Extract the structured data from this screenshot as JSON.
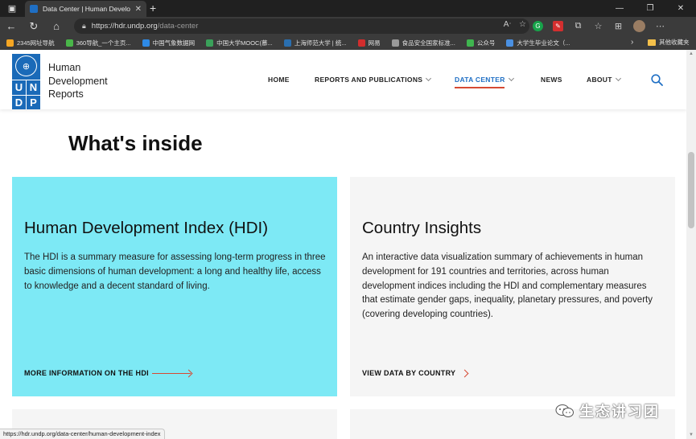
{
  "browser": {
    "tab_title": "Data Center | Human Development Reports",
    "new_tab": "+",
    "url_host": "https://hdr.undp.org",
    "url_path": "/data-center",
    "bookmarks": [
      {
        "label": "2345网址导航",
        "color": "#f5a623"
      },
      {
        "label": "360导航_一个主页...",
        "color": "#49b649"
      },
      {
        "label": "中国气象数据网",
        "color": "#2e8ae6"
      },
      {
        "label": "中国大学MOOC(慕...",
        "color": "#3aa15a"
      },
      {
        "label": "上海师范大学 | 统...",
        "color": "#2a6fb0"
      },
      {
        "label": "网易",
        "color": "#d22d2d"
      },
      {
        "label": "食品安全国家标准...",
        "color": "#9a9a9a"
      },
      {
        "label": "公众号",
        "color": "#3fb54f"
      },
      {
        "label": "大学生毕业论文（...",
        "color": "#4a90e2"
      }
    ],
    "bookmarks_more": "›",
    "other_bookmarks": "其他收藏夹",
    "status_url": "https://hdr.undp.org/data-center/human-development-index"
  },
  "site": {
    "logo_letters": [
      "U",
      "N",
      "D",
      "P"
    ],
    "brand_lines": [
      "Human",
      "Development",
      "Reports"
    ],
    "nav": [
      {
        "label": "HOME",
        "has_dropdown": false,
        "active": false
      },
      {
        "label": "REPORTS AND PUBLICATIONS",
        "has_dropdown": true,
        "active": false
      },
      {
        "label": "DATA CENTER",
        "has_dropdown": true,
        "active": true
      },
      {
        "label": "NEWS",
        "has_dropdown": false,
        "active": false
      },
      {
        "label": "ABOUT",
        "has_dropdown": true,
        "active": false
      }
    ],
    "accent_color": "#d64933",
    "active_color": "#1f6fc4"
  },
  "main": {
    "section_title": "What's inside",
    "cards": [
      {
        "title": "Human Development Index (HDI)",
        "description": "The HDI is a summary measure for assessing long-term progress in three basic dimensions of human development: a long and healthy life, access to knowledge and a decent standard of living.",
        "link": "MORE INFORMATION ON THE HDI",
        "bg_color": "#7de9f5"
      },
      {
        "title": "Country Insights",
        "description": "An interactive data visualization summary of achievements in human development for 191 countries and territories, across human development indices including the HDI and complementary measures that estimate gender gaps, inequality, planetary pressures, and poverty (covering developing countries).",
        "link": "VIEW DATA BY COUNTRY",
        "bg_color": "#f5f5f5"
      }
    ]
  },
  "watermark": {
    "text": "生态讲习团"
  }
}
